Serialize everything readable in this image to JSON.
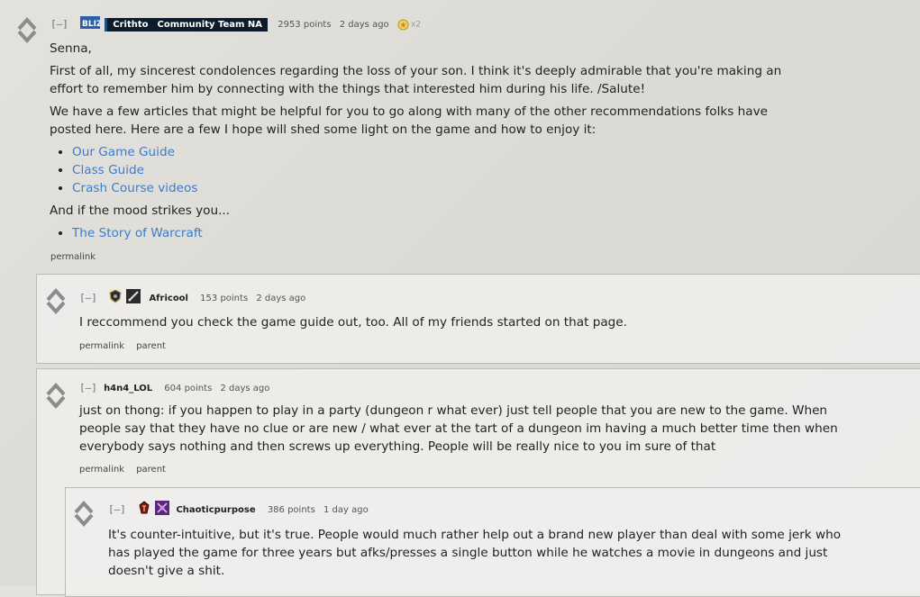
{
  "comments": [
    {
      "author": "Crithto",
      "team": "Community Team NA",
      "badge_label": "BLIZZ",
      "points": "2953 points",
      "time": "2 days ago",
      "gilded": "x2",
      "collapse": "[–]",
      "paragraphs": [
        "Senna,",
        "First of all, my sincerest condolences regarding the loss of your son. I think it's deeply admirable that you're making an effort to remember him by connecting with the things that interested him during his life. /Salute!",
        "We have a few articles that might be helpful for you to go along with many of the other recommendations folks have posted here. Here are a few I hope will shed some light on the game and how to enjoy it:"
      ],
      "links_list": [
        "Our Game Guide",
        "Class Guide",
        "Crash Course videos"
      ],
      "paragraph_after": "And if the mood strikes you...",
      "links_list_2": [
        "The Story of Warcraft"
      ],
      "actions": [
        "permalink"
      ]
    },
    {
      "author": "Africool",
      "points": "153 points",
      "time": "2 days ago",
      "collapse": "[–]",
      "text": "I reccommend you check the game guide out, too. All of my friends started on that page.",
      "actions": [
        "permalink",
        "parent"
      ]
    },
    {
      "author": "h4n4_LOL",
      "points": "604 points",
      "time": "2 days ago",
      "collapse": "[–]",
      "text": "just on thong: if you happen to play in a party (dungeon r what ever) just tell people that you are new to the game. When people say that they have no clue or are new / what ever at the tart of a dungeon im having a much better time then when everybody says nothing and then screws up everything. People will be really nice to you im sure of that",
      "actions": [
        "permalink",
        "parent"
      ]
    },
    {
      "author": "Chaoticpurpose",
      "points": "386 points",
      "time": "1 day ago",
      "collapse": "[–]",
      "text": "It's counter-intuitive, but it's true. People would much rather help out a brand new player than deal with some jerk who has played the game for three years but afks/presses a single button while he watches a movie in dungeons and just doesn't give a shit."
    }
  ],
  "colors": {
    "link": "#3d7cc9",
    "vote_arrow": "#8a8a8a",
    "blizz_bg": "#0d1b2a"
  }
}
